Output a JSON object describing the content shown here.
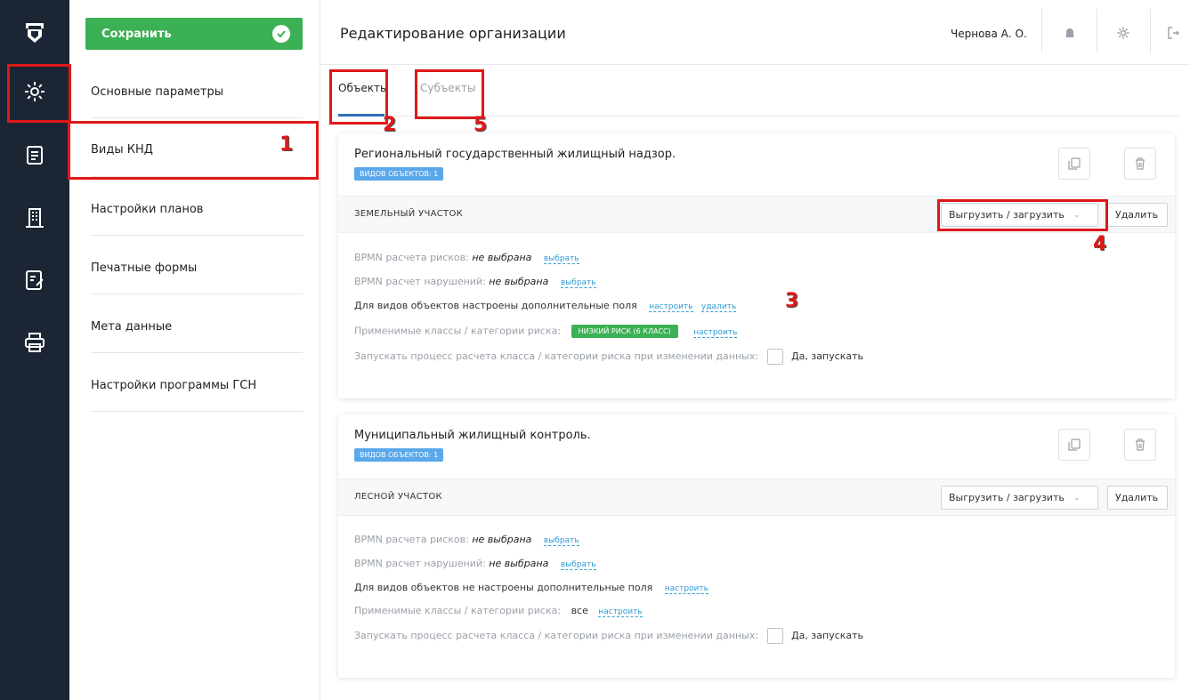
{
  "sidebar": {
    "save_label": "Сохранить",
    "items": [
      {
        "label": "Основные параметры"
      },
      {
        "label": "Виды КНД"
      },
      {
        "label": "Настройки планов"
      },
      {
        "label": "Печатные формы"
      },
      {
        "label": "Мета данные"
      },
      {
        "label": "Настройки программы ГСН"
      }
    ]
  },
  "header": {
    "title": "Редактирование организации",
    "user": "Чернова А. О."
  },
  "tabs": [
    {
      "label": "Объекты",
      "active": true
    },
    {
      "label": "Субъекты",
      "active": false
    }
  ],
  "cards": [
    {
      "title": "Региональный государственный жилищный надзор.",
      "tag": "видов объектов: 1",
      "object_name": "земельный участок",
      "dropdown_label": "Выгрузить / загрузить",
      "delete_label": "Удалить",
      "bpmn_risk_label": "BPMN расчета рисков:",
      "bpmn_risk_value": "не выбрана",
      "bpmn_risk_link": "выбрать",
      "bpmn_viol_label": "BPMN расчет нарушений:",
      "bpmn_viol_value": "не выбрана",
      "bpmn_viol_link": "выбрать",
      "fields_text": "Для видов объектов настроены дополнительные поля",
      "fields_link": "настроить",
      "fields_link2": "удалить",
      "classes_label": "Применимые классы / категории риска:",
      "classes_value": "низкий риск (6 класс)",
      "classes_link": "настроить",
      "process_label": "Запускать процесс расчета класса / категории риска при изменении данных:",
      "process_checkbox_label": "Да, запускать"
    },
    {
      "title": "Муниципальный жилищный контроль.",
      "tag": "видов объектов: 1",
      "object_name": "лесной участок",
      "dropdown_label": "Выгрузить / загрузить",
      "delete_label": "Удалить",
      "bpmn_risk_label": "BPMN расчета рисков:",
      "bpmn_risk_value": "не выбрана",
      "bpmn_risk_link": "выбрать",
      "bpmn_viol_label": "BPMN расчет нарушений:",
      "bpmn_viol_value": "не выбрана",
      "bpmn_viol_link": "выбрать",
      "fields_text": "Для видов объектов не настроены дополнительные поля",
      "fields_link": "настроить",
      "classes_label": "Применимые классы / категории риска:",
      "classes_value": "все",
      "classes_link": "настроить",
      "process_label": "Запускать процесс расчета класса / категории риска при изменении данных:",
      "process_checkbox_label": "Да, запускать"
    }
  ],
  "annotations": [
    "1",
    "2",
    "3",
    "4",
    "5"
  ],
  "colors": {
    "rail": "#1c2533",
    "save_green": "#3cb054",
    "accent_blue": "#2f6fb8",
    "tag_blue": "#5aa7ea",
    "annotation_red": "#e01818"
  },
  "icons": [
    "logo-icon",
    "gear-icon",
    "list-icon",
    "building-icon",
    "edit-doc-icon",
    "printer-icon",
    "check-icon",
    "bell-icon",
    "settings-icon",
    "logout-icon",
    "copy-icon",
    "trash-icon",
    "chevron-down-icon"
  ]
}
